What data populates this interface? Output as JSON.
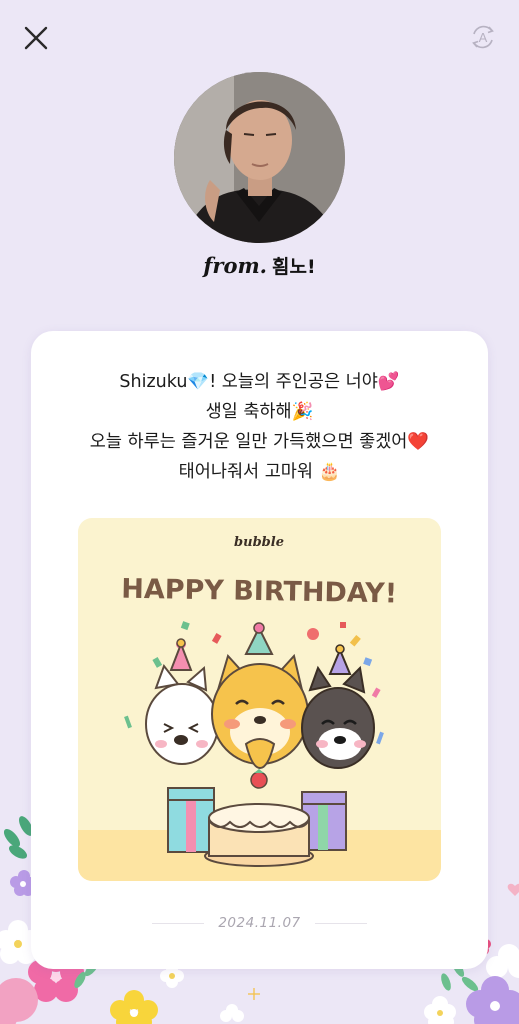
{
  "header": {
    "close_icon": "close-icon",
    "translate_icon": "auto-translate-icon",
    "translate_letter": "A"
  },
  "sender": {
    "from_prefix": "from.",
    "name": "횜노!"
  },
  "letter": {
    "lines": [
      "Shizuku💎! 오늘의 주인공은 너야💕",
      "생일 축하해🎉",
      "오늘 하루는 즐거운 일만 가득했으면 좋겠어❤️",
      "태어나줘서 고마워 🎂"
    ],
    "image": {
      "brand": "bubble",
      "headline": "HAPPY BIRTHDAY!"
    },
    "date": "2024.11.07"
  },
  "colors": {
    "background": "#ece7f6",
    "card": "#ffffff",
    "image_background": "#fbf3cf",
    "image_floor": "#fde4a2",
    "headline": "#7a5a45",
    "date": "#aaa6b0"
  }
}
